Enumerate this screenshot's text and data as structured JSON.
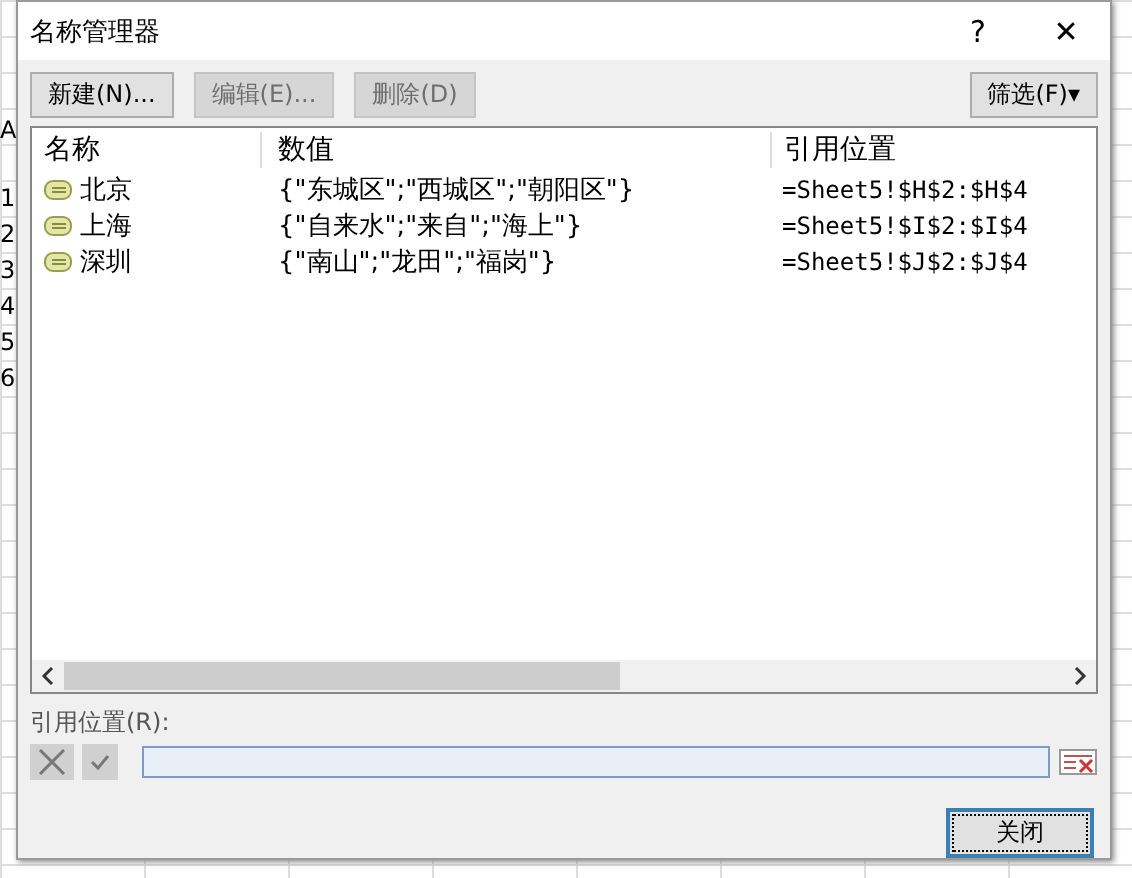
{
  "sheet": {
    "column": "A",
    "row_numbers": [
      "1",
      "2",
      "3",
      "4",
      "5",
      "6"
    ]
  },
  "window": {
    "title": "名称管理器",
    "help": "?",
    "close": "✕"
  },
  "toolbar": [
    {
      "label": "新建(N)...",
      "disabled": false
    },
    {
      "label": "编辑(E)...",
      "disabled": true
    },
    {
      "label": "删除(D)",
      "disabled": true
    }
  ],
  "filter_button": "筛选(F)▾",
  "table": {
    "columns": [
      "名称",
      "数值",
      "引用位置"
    ],
    "rows": [
      {
        "name": "北京",
        "value": "{\"东城区\";\"西城区\";\"朝阳区\"}",
        "ref": "=Sheet5!$H$2:$H$4"
      },
      {
        "name": "上海",
        "value": "{\"自来水\";\"来自\";\"海上\"}",
        "ref": "=Sheet5!$I$2:$I$4"
      },
      {
        "name": "深圳",
        "value": "{\"南山\";\"龙田\";\"福岗\"}",
        "ref": "=Sheet5!$J$2:$J$4"
      }
    ]
  },
  "ref_label": "引用位置(R):",
  "close_button": "关闭"
}
